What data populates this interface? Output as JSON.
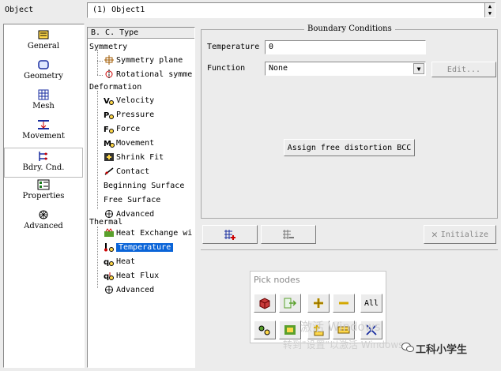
{
  "object": {
    "label": "Object",
    "value": "(1) Object1"
  },
  "nav": [
    {
      "name": "nav-general",
      "label": "General",
      "icon": "general-icon",
      "active": false
    },
    {
      "name": "nav-geometry",
      "label": "Geometry",
      "icon": "geometry-icon",
      "active": false
    },
    {
      "name": "nav-mesh",
      "label": "Mesh",
      "icon": "mesh-icon",
      "active": false
    },
    {
      "name": "nav-movement",
      "label": "Movement",
      "icon": "movement-icon",
      "active": false
    },
    {
      "name": "nav-bdry-cnd",
      "label": "Bdry. Cnd.",
      "icon": "boundary-icon",
      "active": true
    },
    {
      "name": "nav-properties",
      "label": "Properties",
      "icon": "properties-icon",
      "active": false
    },
    {
      "name": "nav-advanced",
      "label": "Advanced",
      "icon": "advanced-icon",
      "active": false
    }
  ],
  "tree": {
    "header": "B. C. Type",
    "groups": [
      {
        "label": "Symmetry",
        "items": [
          {
            "label": "Symmetry plane",
            "icon": "symmetry-plane-icon"
          },
          {
            "label": "Rotational symme",
            "icon": "rotational-symmetry-icon"
          }
        ]
      },
      {
        "label": "Deformation",
        "items": [
          {
            "label": "Velocity",
            "icon": "velocity-icon"
          },
          {
            "label": "Pressure",
            "icon": "pressure-icon"
          },
          {
            "label": "Force",
            "icon": "force-icon"
          },
          {
            "label": "Movement",
            "icon": "movement-bc-icon"
          },
          {
            "label": "Shrink Fit",
            "icon": "shrink-fit-icon"
          },
          {
            "label": "Contact",
            "icon": "contact-icon"
          },
          {
            "label": "Beginning Surface",
            "icon": ""
          },
          {
            "label": "Free Surface",
            "icon": ""
          },
          {
            "label": "Advanced",
            "icon": "advanced-bc-icon"
          }
        ]
      },
      {
        "label": "Thermal",
        "items": [
          {
            "label": "Heat Exchange wi",
            "icon": "heat-exchange-icon"
          },
          {
            "label": "Temperature",
            "icon": "temperature-icon",
            "selected": true
          },
          {
            "label": "Heat",
            "icon": "heat-icon"
          },
          {
            "label": "Heat Flux",
            "icon": "heat-flux-icon"
          },
          {
            "label": "Advanced",
            "icon": "advanced-thermal-icon"
          }
        ]
      }
    ]
  },
  "bc": {
    "title": "Boundary Conditions",
    "temperature_label": "Temperature",
    "temperature_value": "0",
    "function_label": "Function",
    "function_value": "None",
    "edit_label": "Edit...",
    "assign_label": "Assign free distortion BCC"
  },
  "bottom": {
    "initialize_label": "Initialize"
  },
  "pick": {
    "title": "Pick nodes",
    "all_label": "All"
  },
  "watermark": {
    "line1": "激活 Windows",
    "line2": "转到\"设置\"以激活 Windows。"
  },
  "brand": {
    "text": "工科小学生"
  }
}
